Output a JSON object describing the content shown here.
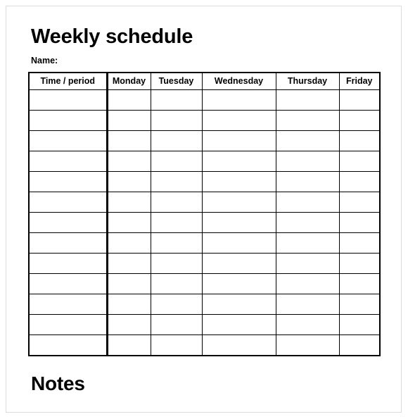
{
  "document": {
    "title": "Weekly schedule",
    "name_label": "Name:",
    "notes_heading": "Notes"
  },
  "table": {
    "columns": [
      {
        "key": "time",
        "label": "Time / period"
      },
      {
        "key": "monday",
        "label": "Monday"
      },
      {
        "key": "tuesday",
        "label": "Tuesday"
      },
      {
        "key": "wednesday",
        "label": "Wednesday"
      },
      {
        "key": "thursday",
        "label": "Thursday"
      },
      {
        "key": "friday",
        "label": "Friday"
      }
    ],
    "row_count": 13,
    "rows": [
      {
        "time": "",
        "monday": "",
        "tuesday": "",
        "wednesday": "",
        "thursday": "",
        "friday": ""
      },
      {
        "time": "",
        "monday": "",
        "tuesday": "",
        "wednesday": "",
        "thursday": "",
        "friday": ""
      },
      {
        "time": "",
        "monday": "",
        "tuesday": "",
        "wednesday": "",
        "thursday": "",
        "friday": ""
      },
      {
        "time": "",
        "monday": "",
        "tuesday": "",
        "wednesday": "",
        "thursday": "",
        "friday": ""
      },
      {
        "time": "",
        "monday": "",
        "tuesday": "",
        "wednesday": "",
        "thursday": "",
        "friday": ""
      },
      {
        "time": "",
        "monday": "",
        "tuesday": "",
        "wednesday": "",
        "thursday": "",
        "friday": ""
      },
      {
        "time": "",
        "monday": "",
        "tuesday": "",
        "wednesday": "",
        "thursday": "",
        "friday": ""
      },
      {
        "time": "",
        "monday": "",
        "tuesday": "",
        "wednesday": "",
        "thursday": "",
        "friday": ""
      },
      {
        "time": "",
        "monday": "",
        "tuesday": "",
        "wednesday": "",
        "thursday": "",
        "friday": ""
      },
      {
        "time": "",
        "monday": "",
        "tuesday": "",
        "wednesday": "",
        "thursday": "",
        "friday": ""
      },
      {
        "time": "",
        "monday": "",
        "tuesday": "",
        "wednesday": "",
        "thursday": "",
        "friday": ""
      },
      {
        "time": "",
        "monday": "",
        "tuesday": "",
        "wednesday": "",
        "thursday": "",
        "friday": ""
      },
      {
        "time": "",
        "monday": "",
        "tuesday": "",
        "wednesday": "",
        "thursday": "",
        "friday": ""
      }
    ]
  },
  "style": {
    "page_background": "#ffffff",
    "page_border": "#dcdcdc",
    "ink": "#000000"
  }
}
